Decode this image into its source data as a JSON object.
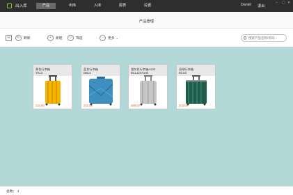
{
  "app": {
    "brand": "出入库",
    "user": "Daniel",
    "logout": "退出"
  },
  "nav": {
    "tabs": [
      "产品",
      "出库",
      "入库",
      "报表",
      "设置"
    ],
    "active": "产品"
  },
  "window_controls": [
    "–",
    "▢",
    "✕"
  ],
  "page": {
    "title": "产品管理"
  },
  "toolbar": {
    "refresh_label": "刷新",
    "add_label": "新建",
    "filter_label": "筛选",
    "more_label": "更多",
    "search_placeholder": "搜索产品名称/条码..."
  },
  "products": [
    {
      "name": "黄色行李箱",
      "code": "YEL3",
      "price": "224.00",
      "color": "#f5b400",
      "dark": "#c98a00"
    },
    {
      "name": "蓝色行李箱",
      "code": "DBL3",
      "price": "203.00",
      "color": "#3e8fc0",
      "dark": "#2a6b94"
    },
    {
      "name": "银灰色行李箱A100",
      "code": "BCL124A100",
      "price": "488.00",
      "color": "#c6c6c6",
      "dark": "#8f8f8f"
    },
    {
      "name": "深绿行李箱",
      "code": "BCS3",
      "price": "203.00",
      "color": "#1e5b4a",
      "dark": "#123a2f"
    }
  ],
  "footer": {
    "total_label": "总数： 4"
  },
  "colors": {
    "topbar": "#2e2e2e",
    "content_bg": "#b2d8d8",
    "price": "#e5612e"
  }
}
